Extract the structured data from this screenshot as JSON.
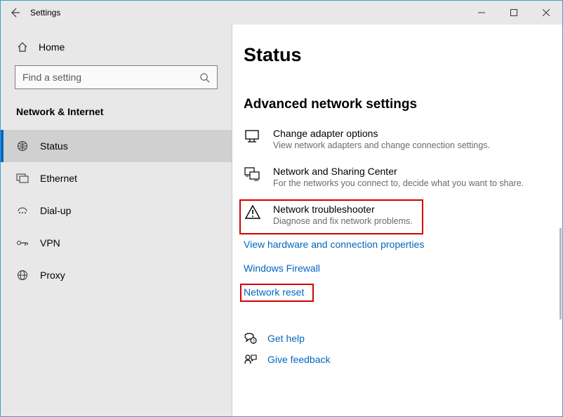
{
  "titlebar": {
    "title": "Settings"
  },
  "sidebar": {
    "home_label": "Home",
    "search_placeholder": "Find a setting",
    "section_label": "Network & Internet",
    "items": [
      {
        "label": "Status"
      },
      {
        "label": "Ethernet"
      },
      {
        "label": "Dial-up"
      },
      {
        "label": "VPN"
      },
      {
        "label": "Proxy"
      }
    ]
  },
  "content": {
    "h1": "Status",
    "h2": "Advanced network settings",
    "options": [
      {
        "title": "Change adapter options",
        "desc": "View network adapters and change connection settings."
      },
      {
        "title": "Network and Sharing Center",
        "desc": "For the networks you connect to, decide what you want to share."
      },
      {
        "title": "Network troubleshooter",
        "desc": "Diagnose and fix network problems."
      }
    ],
    "links": {
      "view_hw": "View hardware and connection properties",
      "firewall": "Windows Firewall",
      "reset": "Network reset"
    },
    "help": {
      "get_help": "Get help",
      "feedback": "Give feedback"
    }
  }
}
